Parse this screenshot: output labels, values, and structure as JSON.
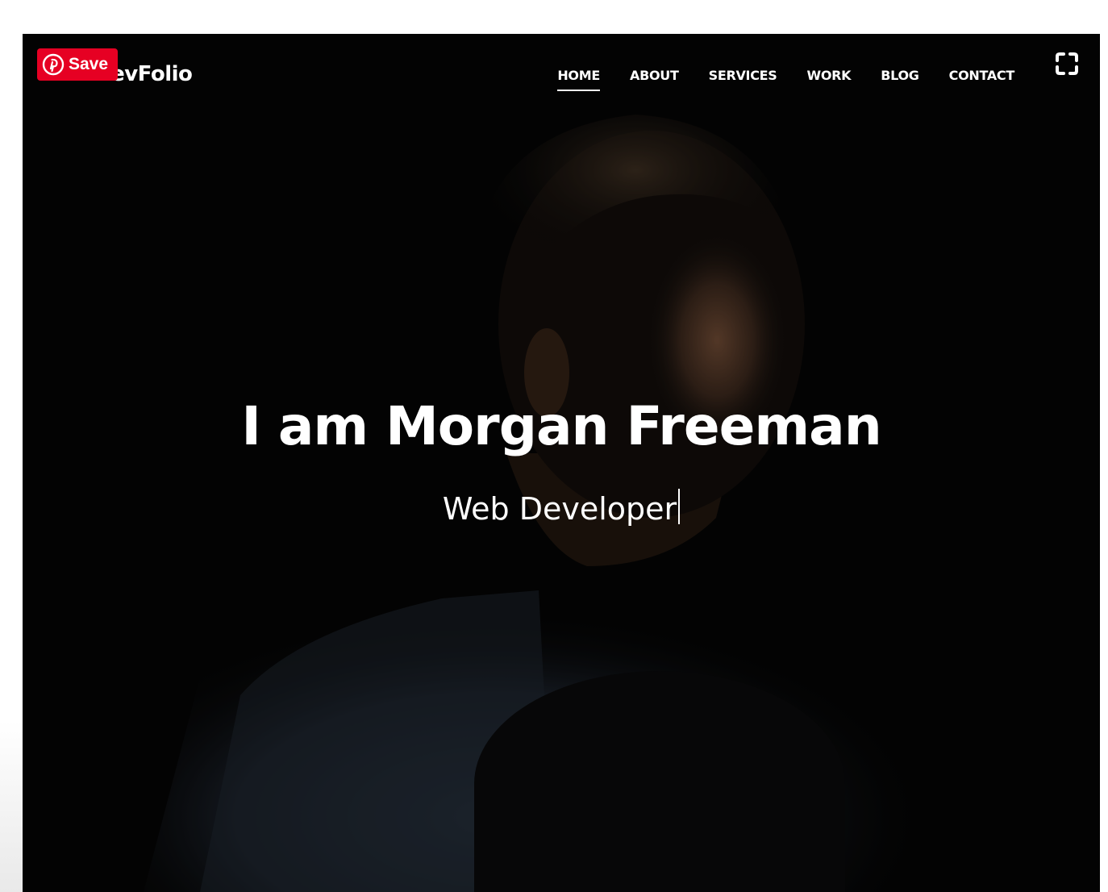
{
  "brand": {
    "name": "DevFolio"
  },
  "nav": {
    "items": [
      {
        "label": "HOME",
        "active": true
      },
      {
        "label": "ABOUT",
        "active": false
      },
      {
        "label": "SERVICES",
        "active": false
      },
      {
        "label": "WORK",
        "active": false
      },
      {
        "label": "BLOG",
        "active": false
      },
      {
        "label": "CONTACT",
        "active": false
      }
    ]
  },
  "hero": {
    "title": "I am Morgan Freeman",
    "subtitle": "Web Developer"
  },
  "pinterest": {
    "label": "Save",
    "color": "#e60023",
    "icon": "pinterest-icon"
  },
  "controls": {
    "fullscreen_icon": "fullscreen-icon"
  },
  "colors": {
    "background": "#050505",
    "text": "#ffffff"
  }
}
